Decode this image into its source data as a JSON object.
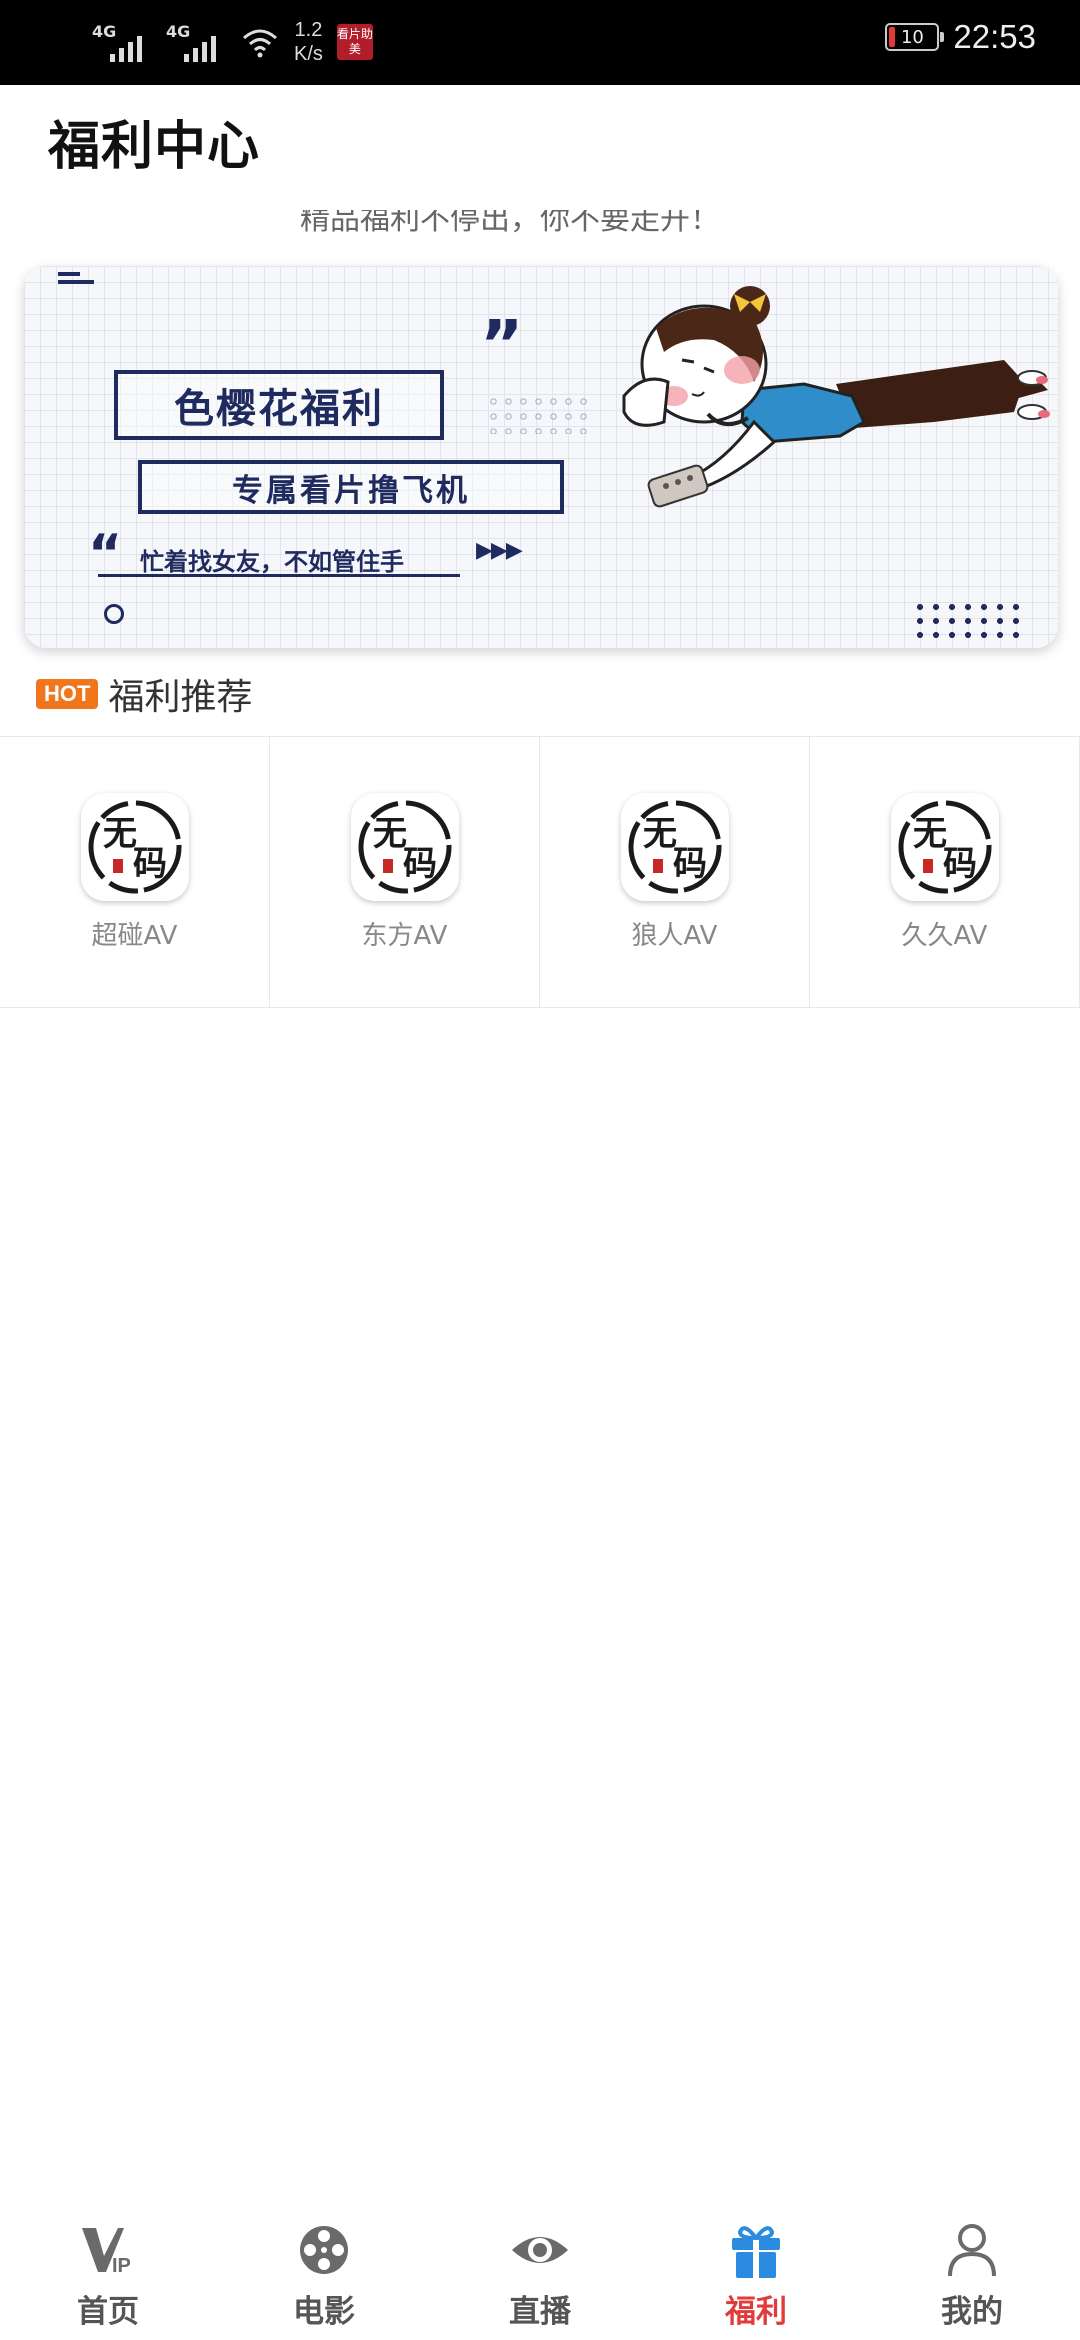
{
  "status_bar": {
    "signal_1": "4G",
    "signal_2": "4G",
    "net_speed_value": "1.2",
    "net_speed_unit": "K/s",
    "app_badge": "看片助美",
    "battery": "10",
    "time": "22:53"
  },
  "header": {
    "title": "福利中心",
    "notice": "精品福利不停出，你不要走开！"
  },
  "banner": {
    "title": "色樱花福利",
    "subtitle": "专属看片撸飞机",
    "tagline": "忙着找女友，不如管住手",
    "arrows": "▶▶▶",
    "quote_open": "“",
    "quote_close": "”"
  },
  "section": {
    "badge": "HOT",
    "title": "福利推荐"
  },
  "apps": [
    {
      "label": "超碰AV",
      "icon_text_1": "无",
      "icon_text_2": "码"
    },
    {
      "label": "东方AV",
      "icon_text_1": "无",
      "icon_text_2": "码"
    },
    {
      "label": "狼人AV",
      "icon_text_1": "无",
      "icon_text_2": "码"
    },
    {
      "label": "久久AV",
      "icon_text_1": "无",
      "icon_text_2": "码"
    }
  ],
  "nav": {
    "items": [
      {
        "label": "首页",
        "icon": "vip-icon",
        "active": false
      },
      {
        "label": "电影",
        "icon": "film-reel-icon",
        "active": false
      },
      {
        "label": "直播",
        "icon": "eye-icon",
        "active": false
      },
      {
        "label": "福利",
        "icon": "gift-icon",
        "active": true
      },
      {
        "label": "我的",
        "icon": "user-icon",
        "active": false
      }
    ]
  },
  "colors": {
    "accent_active": "#e23b3b",
    "gift_blue": "#2a8be0",
    "hot_orange": "#f0751b",
    "banner_navy": "#1f2a5e"
  }
}
